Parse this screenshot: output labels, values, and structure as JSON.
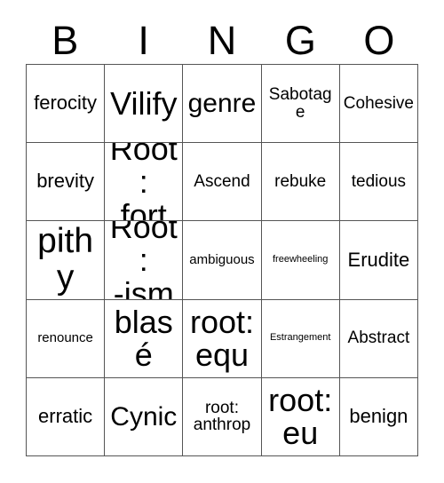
{
  "card": {
    "header_letters": [
      "B",
      "I",
      "N",
      "G",
      "O"
    ],
    "rows": [
      [
        {
          "text": "ferocity",
          "size": "lg"
        },
        {
          "text": "Vilify",
          "size": "xxl"
        },
        {
          "text": "genre",
          "size": "xl"
        },
        {
          "text": "Sabotage",
          "size": "md"
        },
        {
          "text": "Cohesive",
          "size": "md"
        }
      ],
      [
        {
          "text": "brevity",
          "size": "lg"
        },
        {
          "text": "Root:\nfort",
          "size": "xxl"
        },
        {
          "text": "Ascend",
          "size": "md"
        },
        {
          "text": "rebuke",
          "size": "md"
        },
        {
          "text": "tedious",
          "size": "md"
        }
      ],
      [
        {
          "text": "pithy",
          "size": "huge"
        },
        {
          "text": "Root:\n-ism",
          "size": "xxl"
        },
        {
          "text": "ambiguous",
          "size": "sm"
        },
        {
          "text": "freewheeling",
          "size": "xs"
        },
        {
          "text": "Erudite",
          "size": "lg"
        }
      ],
      [
        {
          "text": "renounce",
          "size": "sm"
        },
        {
          "text": "blasé",
          "size": "xxl"
        },
        {
          "text": "root:\nequ",
          "size": "xxl"
        },
        {
          "text": "Estrangement",
          "size": "xs"
        },
        {
          "text": "Abstract",
          "size": "md"
        }
      ],
      [
        {
          "text": "erratic",
          "size": "lg"
        },
        {
          "text": "Cynic",
          "size": "xl"
        },
        {
          "text": "root:\nanthrop",
          "size": "md"
        },
        {
          "text": "root:\neu",
          "size": "xxl"
        },
        {
          "text": "benign",
          "size": "lg"
        }
      ]
    ],
    "colors": {
      "grid_line": "#555555",
      "text": "#000000",
      "background": "#ffffff"
    }
  }
}
